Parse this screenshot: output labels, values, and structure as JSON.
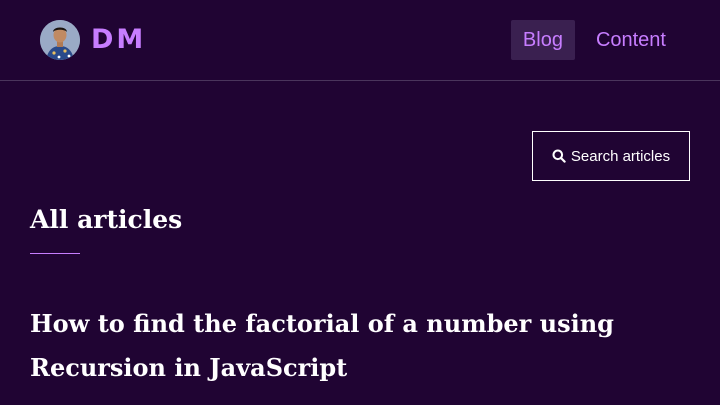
{
  "brand": {
    "name": "DM",
    "color": "#c77dff"
  },
  "nav": {
    "items": [
      {
        "label": "Blog",
        "active": true
      },
      {
        "label": "Content",
        "active": false
      }
    ]
  },
  "search": {
    "label": "Search articles",
    "icon": "search-icon"
  },
  "main": {
    "heading": "All articles",
    "articles": [
      {
        "title": "How to find the factorial of a number using Recursion in JavaScript"
      }
    ]
  },
  "colors": {
    "background": "#200433",
    "accent": "#c77dff",
    "text": "#ffffff"
  }
}
